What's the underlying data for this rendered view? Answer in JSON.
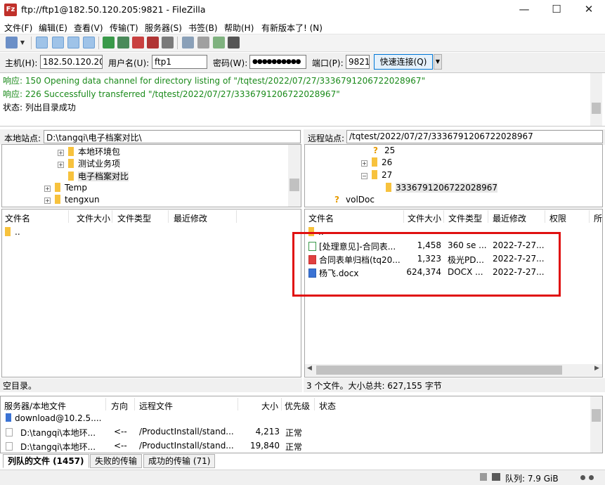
{
  "window": {
    "title": "ftp://ftp1@182.50.120.205:9821 - FileZilla",
    "app_icon": "Fz",
    "minimize": "—",
    "maximize": "☐",
    "close": "✕"
  },
  "menu": [
    "文件(F)",
    "编辑(E)",
    "查看(V)",
    "传输(T)",
    "服务器(S)",
    "书签(B)",
    "帮助(H)",
    "有新版本了! (N)"
  ],
  "quickconnect": {
    "host_label": "主机(H):",
    "host_value": "182.50.120.205",
    "user_label": "用户名(U):",
    "user_value": "ftp1",
    "pass_label": "密码(W):",
    "pass_value": "●●●●●●●●●●",
    "port_label": "端口(P):",
    "port_value": "9821",
    "connect_label": "快速连接(Q)",
    "dropdown": "▼"
  },
  "log": [
    {
      "text": "响应: 150 Opening data channel for directory listing of \"/tqtest/2022/07/27/3336791206722028967\"",
      "color": "#1a8a1a"
    },
    {
      "text": "响应: 226 Successfully transferred \"/tqtest/2022/07/27/3336791206722028967\"",
      "color": "#1a8a1a"
    },
    {
      "text": "状态: 列出目录成功",
      "color": "#000000"
    }
  ],
  "local": {
    "site_label": "本地站点:",
    "site_path": "D:\\tangqi\\电子档案对比\\",
    "tree": [
      {
        "label": "本地环境包",
        "pm": "+"
      },
      {
        "label": "测试业务项",
        "pm": "+"
      },
      {
        "label": "电子档案对比",
        "pm": ""
      },
      {
        "label": "Temp",
        "pm": "+"
      },
      {
        "label": "tengxun",
        "pm": "+"
      }
    ],
    "columns": [
      "文件名",
      "文件大小",
      "文件类型",
      "最近修改"
    ],
    "parent_row": "..",
    "status": "空目录。"
  },
  "remote": {
    "site_label": "远程站点:",
    "site_path": "/tqtest/2022/07/27/3336791206722028967",
    "tree": [
      {
        "label": "25",
        "pm": ""
      },
      {
        "label": "26",
        "pm": "+"
      },
      {
        "label": "27",
        "pm": "−"
      },
      {
        "label": "3336791206722028967",
        "pm": ""
      },
      {
        "label": "volDoc",
        "pm": ""
      }
    ],
    "columns": [
      "文件名",
      "文件大小",
      "文件类型",
      "最近修改",
      "权限",
      "所"
    ],
    "parent_row": "..",
    "files": [
      {
        "name": "[处理意见]-合同表...",
        "size": "1,458",
        "type": "360 se ...",
        "modified": "2022-7-27..."
      },
      {
        "name": "合同表单归档(tq20...",
        "size": "1,323",
        "type": "极光PD...",
        "modified": "2022-7-27..."
      },
      {
        "name": "杨飞.docx",
        "size": "624,374",
        "type": "DOCX ...",
        "modified": "2022-7-27..."
      }
    ],
    "status": "3 个文件。大小总共: 627,155 字节"
  },
  "queue": {
    "columns": [
      "服务器/本地文件",
      "方向",
      "远程文件",
      "大小",
      "优先级",
      "状态"
    ],
    "rows": [
      {
        "local": "download@10.2.5....",
        "dir": "",
        "remote": "",
        "size": "",
        "prio": ""
      },
      {
        "local": "D:\\tangqi\\本地环...",
        "dir": "<--",
        "remote": "/ProductInstall/stand...",
        "size": "4,213",
        "prio": "正常"
      },
      {
        "local": "D:\\tangqi\\本地环...",
        "dir": "<--",
        "remote": "/ProductInstall/stand...",
        "size": "19,840",
        "prio": "正常"
      }
    ],
    "tabs": [
      "列队的文件 (1457)",
      "失败的传输",
      "成功的传输 (71)"
    ]
  },
  "statusbar": {
    "queue_label": "队列: 7.9 GiB"
  },
  "colors": {
    "highlight": "#e01010",
    "success_text": "#1a8a1a",
    "accent": "#0078d7"
  }
}
